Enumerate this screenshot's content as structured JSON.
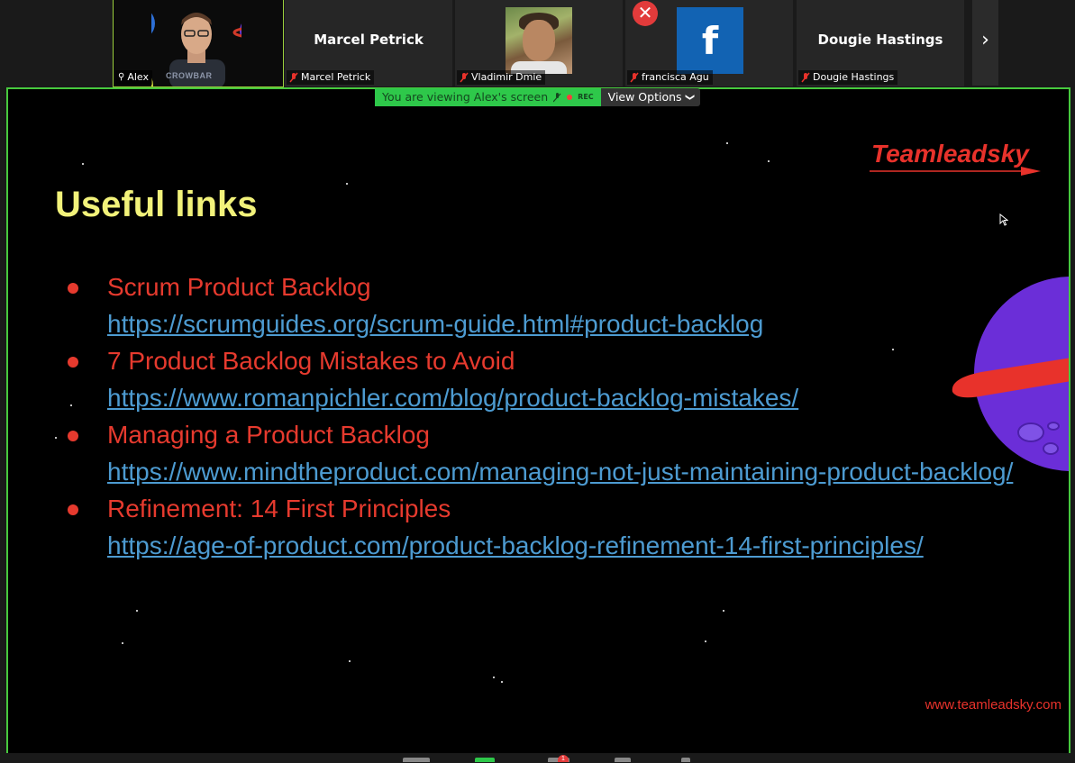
{
  "participants": [
    {
      "name": "Alex",
      "type": "video",
      "active": true
    },
    {
      "name": "Marcel Petrick",
      "display": "Marcel Petrick",
      "type": "name-only"
    },
    {
      "name": "Vladimir Dmie",
      "type": "photo"
    },
    {
      "name": "francisca Agu",
      "type": "facebook-avatar",
      "avatar_letter": "f",
      "close_badge": "✕"
    },
    {
      "name": "Dougie Hastings",
      "display": "Dougie Hastings",
      "type": "name-only"
    }
  ],
  "strip": {
    "next_icon": "chevron-right-icon",
    "next_glyph": "›"
  },
  "share_banner": {
    "text": "You are viewing Alex's screen",
    "rec": "REC",
    "view_options": "View Options",
    "view_options_glyph": "❯"
  },
  "alex_tile_text": "CROWBAR",
  "slide": {
    "title": "Useful links",
    "logo": "Teamleadsky",
    "footer_url": "www.teamleadsky.com",
    "items": [
      {
        "title": "Scrum Product Backlog",
        "link": "https://scrumguides.org/scrum-guide.html#product-backlog"
      },
      {
        "title": "7 Product Backlog Mistakes to Avoid",
        "link": "https://www.romanpichler.com/blog/product-backlog-mistakes/"
      },
      {
        "title": "Managing a Product Backlog",
        "link": "https://www.mindtheproduct.com/managing-not-just-maintaining-product-backlog/"
      },
      {
        "title": "Refinement: 14 First Principles",
        "link": "https://age-of-product.com/product-backlog-refinement-14-first-principles/"
      }
    ]
  },
  "colors": {
    "active_border": "#47c93e",
    "slide_title": "#f2f27a",
    "slide_text": "#e63a2e",
    "slide_link": "#4d9bd1",
    "banner_green": "#2ec84a"
  },
  "toolbar": {
    "badge_count": "1"
  }
}
